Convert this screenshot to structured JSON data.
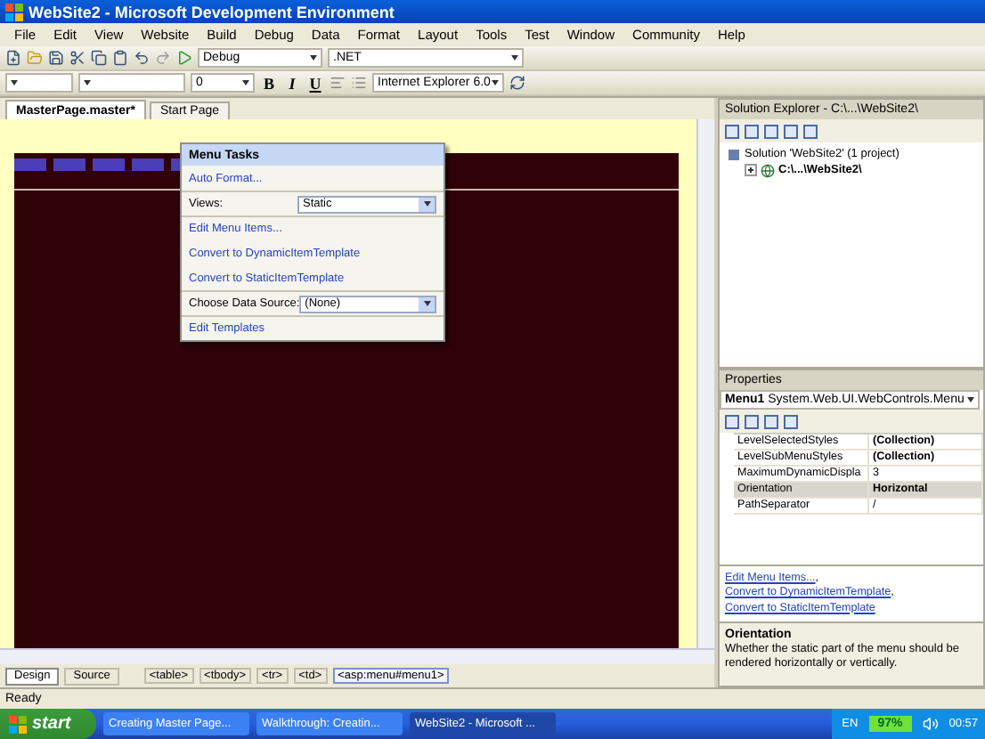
{
  "window": {
    "title": "WebSite2 - Microsoft Development Environment"
  },
  "menu": [
    "File",
    "Edit",
    "View",
    "Website",
    "Build",
    "Debug",
    "Data",
    "Format",
    "Layout",
    "Tools",
    "Test",
    "Window",
    "Community",
    "Help"
  ],
  "toolbar": {
    "config": "Debug",
    "platform": ".NET"
  },
  "format_toolbar": {
    "size": "0",
    "bold": "B",
    "italic": "I",
    "underline": "U",
    "target": "Internet Explorer 6.0"
  },
  "doc_tabs": [
    {
      "label": "MasterPage.master*",
      "selected": true
    },
    {
      "label": "Start Page",
      "selected": false
    }
  ],
  "menu_tasks": {
    "title": "Menu Tasks",
    "items": [
      {
        "kind": "link",
        "text": "Auto Format...",
        "group_start": false
      },
      {
        "kind": "select",
        "label": "Views:",
        "value": "Static",
        "group_start": true
      },
      {
        "kind": "link",
        "text": "Edit Menu Items...",
        "group_start": true
      },
      {
        "kind": "link",
        "text": "Convert to DynamicItemTemplate",
        "group_start": false
      },
      {
        "kind": "link",
        "text": "Convert to StaticItemTemplate",
        "group_start": false
      },
      {
        "kind": "select",
        "label": "Choose Data Source:",
        "value": "(None)",
        "group_start": true
      },
      {
        "kind": "link",
        "text": "Edit Templates",
        "group_start": true
      }
    ]
  },
  "view_tabs": [
    {
      "label": "Design",
      "selected": true
    },
    {
      "label": "Source",
      "selected": false
    }
  ],
  "tag_path": [
    {
      "label": "<table>",
      "selected": false
    },
    {
      "label": "<tbody>",
      "selected": false
    },
    {
      "label": "<tr>",
      "selected": false
    },
    {
      "label": "<td>",
      "selected": false
    },
    {
      "label": "<asp:menu#menu1>",
      "selected": true
    }
  ],
  "status": "Ready",
  "solution_explorer": {
    "title": "Solution Explorer - C:\\...\\WebSite2\\",
    "tree": [
      {
        "label": "Solution 'WebSite2' (1 project)",
        "children": [
          {
            "label": "C:\\...\\WebSite2\\",
            "expanded": false
          }
        ]
      }
    ]
  },
  "properties": {
    "title": "Properties",
    "object": "Menu1",
    "object_type": "System.Web.UI.WebControls.Menu",
    "rows": [
      {
        "name": "LevelSelectedStyles",
        "value": "(Collection)",
        "bold": true,
        "selected": false
      },
      {
        "name": "LevelSubMenuStyles",
        "value": "(Collection)",
        "bold": true,
        "selected": false
      },
      {
        "name": "MaximumDynamicDispla",
        "value": "3",
        "bold": false,
        "selected": false
      },
      {
        "name": "Orientation",
        "value": "Horizontal",
        "bold": true,
        "selected": true
      },
      {
        "name": "PathSeparator",
        "value": "/",
        "bold": false,
        "selected": false
      }
    ],
    "commands": [
      "Edit Menu Items...",
      "Convert to DynamicItemTemplate",
      "Convert to StaticItemTemplate"
    ],
    "command_separator": ",",
    "description": {
      "title": "Orientation",
      "text": "Whether the static part of the menu should be rendered horizontally or vertically."
    }
  },
  "taskbar": {
    "start": "start",
    "tasks": [
      {
        "label": "Creating Master Page...",
        "selected": false
      },
      {
        "label": "Walkthrough: Creatin...",
        "selected": false
      },
      {
        "label": "WebSite2 - Microsoft ...",
        "selected": true
      }
    ],
    "lang": "EN",
    "battery": "97%",
    "clock": "00:57"
  }
}
